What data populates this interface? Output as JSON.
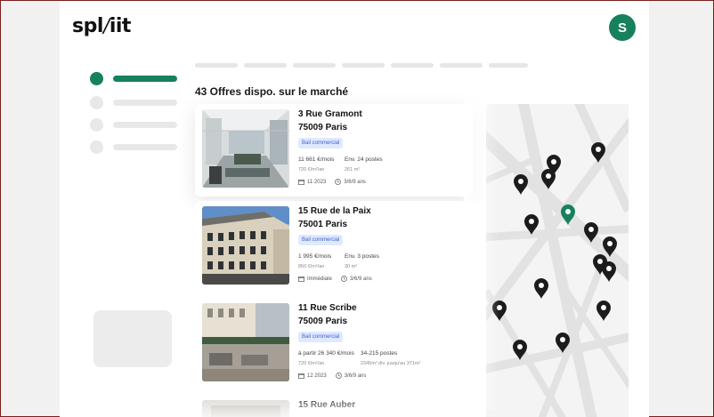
{
  "app": {
    "logo_left": "spl",
    "logo_slash": "/",
    "logo_right": "iit",
    "avatar_initial": "S",
    "accent_color": "#17805c"
  },
  "listings": {
    "heading": "43 Offres dispo. sur le marché",
    "items": [
      {
        "street": "3 Rue Gramont",
        "city": "75009 Paris",
        "badge": "Bail commercial",
        "price": "11 661 €/mois",
        "price_sub": "720 €/m²/an",
        "posts": "Env. 24 postes",
        "posts_sub": "261 m²",
        "date": "11 2023",
        "lease": "3/6/9 ans"
      },
      {
        "street": "15 Rue de la Paix",
        "city": "75001 Paris",
        "badge": "Bail commercial",
        "price": "1 995 €/mois",
        "price_sub": "850 €/m²/an",
        "posts": "Env. 3 postes",
        "posts_sub": "30 m²",
        "date": "Immédiate",
        "lease": "3/6/9 ans"
      },
      {
        "street": "11 Rue Scribe",
        "city": "75009 Paris",
        "badge": "Bail commercial",
        "price": "à partir 26 340 €/mois",
        "price_sub": "720 €/m²/an",
        "posts": "34-215 postes",
        "posts_sub": "2345m² div. jusqu'au 371m²",
        "date": "12 2023",
        "lease": "3/6/9 ans"
      },
      {
        "street": "15 Rue Auber"
      }
    ]
  },
  "map": {
    "pin_color": "#1c1c1c",
    "selected_pin_color": "#17805c",
    "pin_count": 16,
    "selected_pins": 1
  }
}
